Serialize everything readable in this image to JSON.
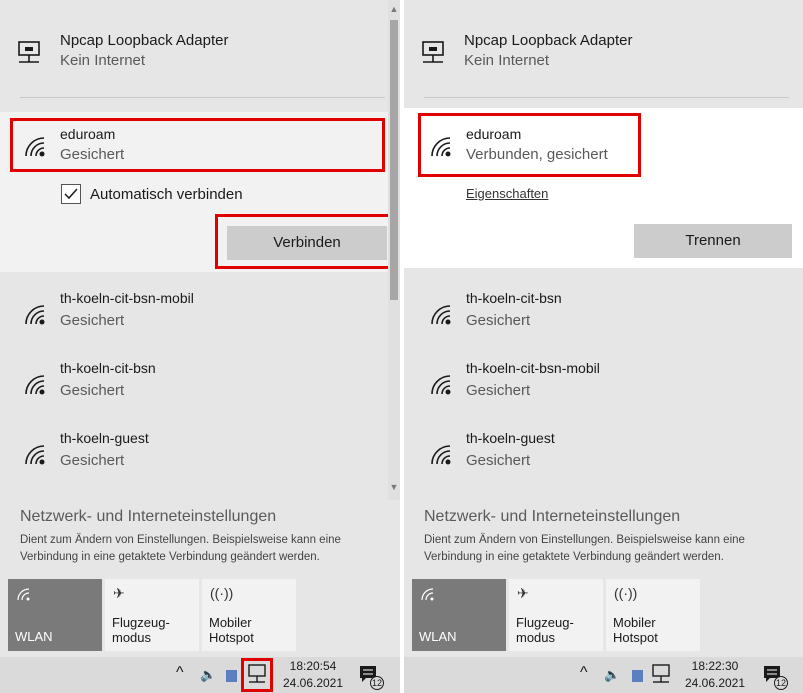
{
  "left": {
    "adapter": {
      "name": "Npcap Loopback Adapter",
      "status": "Kein Internet"
    },
    "expanded": {
      "name": "eduroam",
      "status": "Gesichert",
      "auto_connect_label": "Automatisch verbinden",
      "connect_label": "Verbinden"
    },
    "networks": [
      {
        "name": "th-koeln-cit-bsn-mobil",
        "status": "Gesichert"
      },
      {
        "name": "th-koeln-cit-bsn",
        "status": "Gesichert"
      },
      {
        "name": "th-koeln-guest",
        "status": "Gesichert"
      }
    ],
    "settings": {
      "title": "Netzwerk- und Interneteinstellungen",
      "description": "Dient zum Ändern von Einstellungen. Beispielsweise kann eine Verbindung in eine getaktete Verbindung geändert werden."
    },
    "tiles": {
      "wlan": "WLAN",
      "airplane_1": "Flugzeug-",
      "airplane_2": "modus",
      "hotspot_1": "Mobiler",
      "hotspot_2": "Hotspot"
    },
    "taskbar": {
      "time": "18:20:54",
      "date": "24.06.2021",
      "notifications": "12"
    }
  },
  "right": {
    "adapter": {
      "name": "Npcap Loopback Adapter",
      "status": "Kein Internet"
    },
    "expanded": {
      "name": "eduroam",
      "status": "Verbunden, gesichert",
      "properties_label": "Eigenschaften",
      "disconnect_label": "Trennen"
    },
    "networks": [
      {
        "name": "th-koeln-cit-bsn",
        "status": "Gesichert"
      },
      {
        "name": "th-koeln-cit-bsn-mobil",
        "status": "Gesichert"
      },
      {
        "name": "th-koeln-guest",
        "status": "Gesichert"
      }
    ],
    "settings": {
      "title": "Netzwerk- und Interneteinstellungen",
      "description": "Dient zum Ändern von Einstellungen. Beispielsweise kann eine Verbindung in eine getaktete Verbindung geändert werden."
    },
    "tiles": {
      "wlan": "WLAN",
      "airplane_1": "Flugzeug-",
      "airplane_2": "modus",
      "hotspot_1": "Mobiler",
      "hotspot_2": "Hotspot"
    },
    "taskbar": {
      "time": "18:22:30",
      "date": "24.06.2021",
      "notifications": "12"
    }
  },
  "colors": {
    "highlight": "#e00000",
    "active_tile": "#7a7a7a",
    "panel_bg": "#e6e6e6"
  }
}
